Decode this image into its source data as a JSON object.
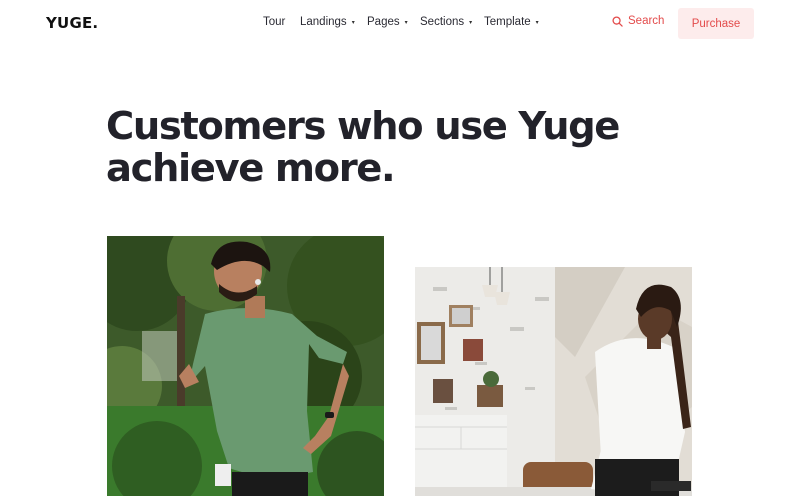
{
  "brand": {
    "logo_text": "YUGE."
  },
  "nav": {
    "items": [
      {
        "label": "Tour",
        "has_dropdown": false
      },
      {
        "label": "Landings",
        "has_dropdown": true
      },
      {
        "label": "Pages",
        "has_dropdown": true
      },
      {
        "label": "Sections",
        "has_dropdown": true
      },
      {
        "label": "Template",
        "has_dropdown": true
      }
    ],
    "search_label": "Search",
    "purchase_label": "Purchase",
    "dropdown_caret": "▾"
  },
  "hero": {
    "headline_line1": "Customers who use Yuge",
    "headline_line2": "achieve more."
  },
  "gallery": {
    "images": [
      {
        "subject": "man-running-outdoors"
      },
      {
        "subject": "woman-at-desk-in-kitchen"
      }
    ]
  },
  "colors": {
    "accent": "#e34b4b",
    "accent_soft_bg": "#fdecec",
    "heading": "#22222a",
    "background": "#ffffff"
  },
  "icons": {
    "search": "search-icon",
    "caret": "chevron-down-icon"
  }
}
